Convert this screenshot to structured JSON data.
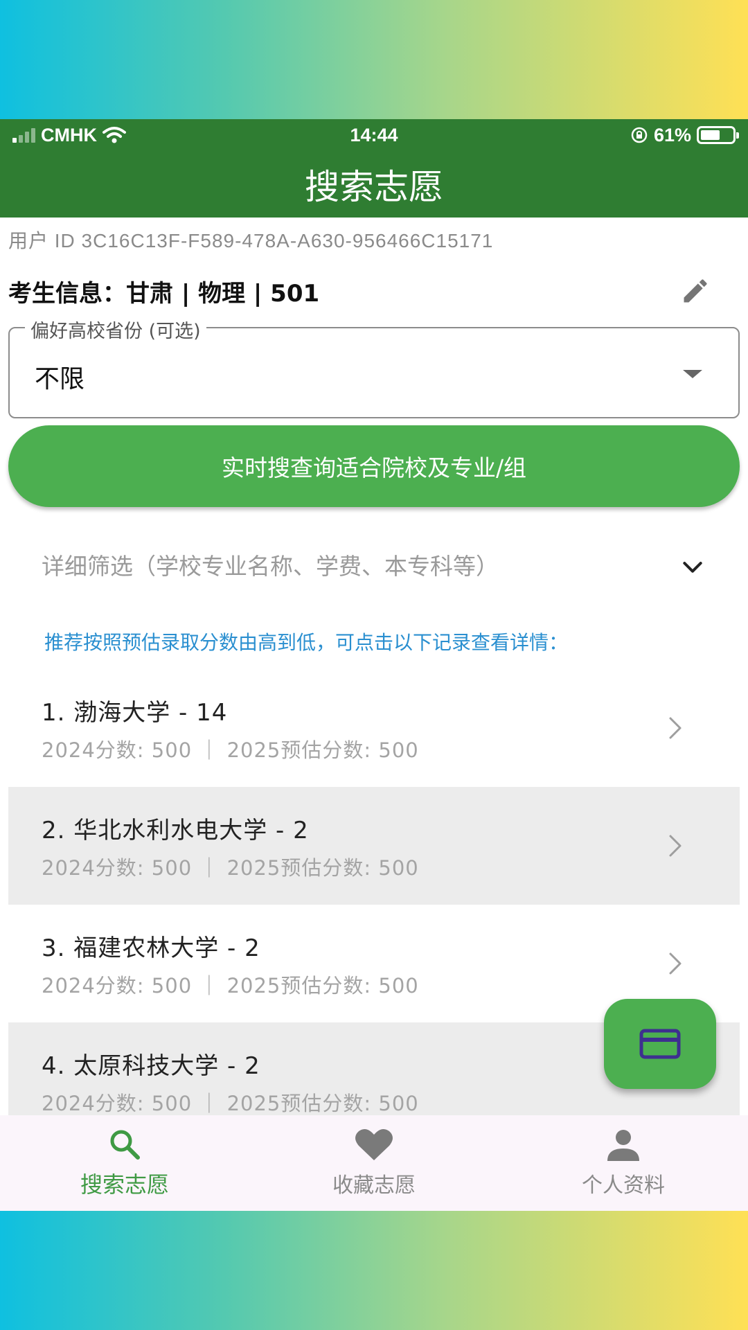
{
  "status_bar": {
    "carrier": "CMHK",
    "time": "14:44",
    "battery": "61%",
    "battery_level": 0.61
  },
  "app_bar": {
    "title": "搜索志愿"
  },
  "user_id": "用户 ID 3C16C13F-F589-478A-A630-956466C15171",
  "student_info": "考生信息：甘肃 | 物理 | 501",
  "province_select": {
    "label": "偏好高校省份 (可选)",
    "value": "不限"
  },
  "search_button": "实时搜查询适合院校及专业/组",
  "filter": {
    "label": "详细筛选（学校专业名称、学费、本专科等）"
  },
  "hint": "推荐按照预估录取分数由高到低，可点击以下记录查看详情：",
  "results": [
    {
      "title": "1. 渤海大学 - 14",
      "subtitle": "2024分数: 500  ｜  2025预估分数: 500"
    },
    {
      "title": "2. 华北水利水电大学 - 2",
      "subtitle": "2024分数: 500  ｜  2025预估分数: 500"
    },
    {
      "title": "3. 福建农林大学 - 2",
      "subtitle": "2024分数: 500  ｜  2025预估分数: 500"
    },
    {
      "title": "4. 太原科技大学 - 2",
      "subtitle": "2024分数: 500  ｜  2025预估分数: 500"
    }
  ],
  "bottom_nav": [
    {
      "label": "搜索志愿",
      "icon": "search-icon",
      "active": true
    },
    {
      "label": "收藏志愿",
      "icon": "heart-icon",
      "active": false
    },
    {
      "label": "个人资料",
      "icon": "person-icon",
      "active": false
    }
  ],
  "colors": {
    "app_bar": "#2f7d32",
    "accent": "#4caf50",
    "hint": "#2a8fd0",
    "fab_icon": "#3d2f8f"
  }
}
